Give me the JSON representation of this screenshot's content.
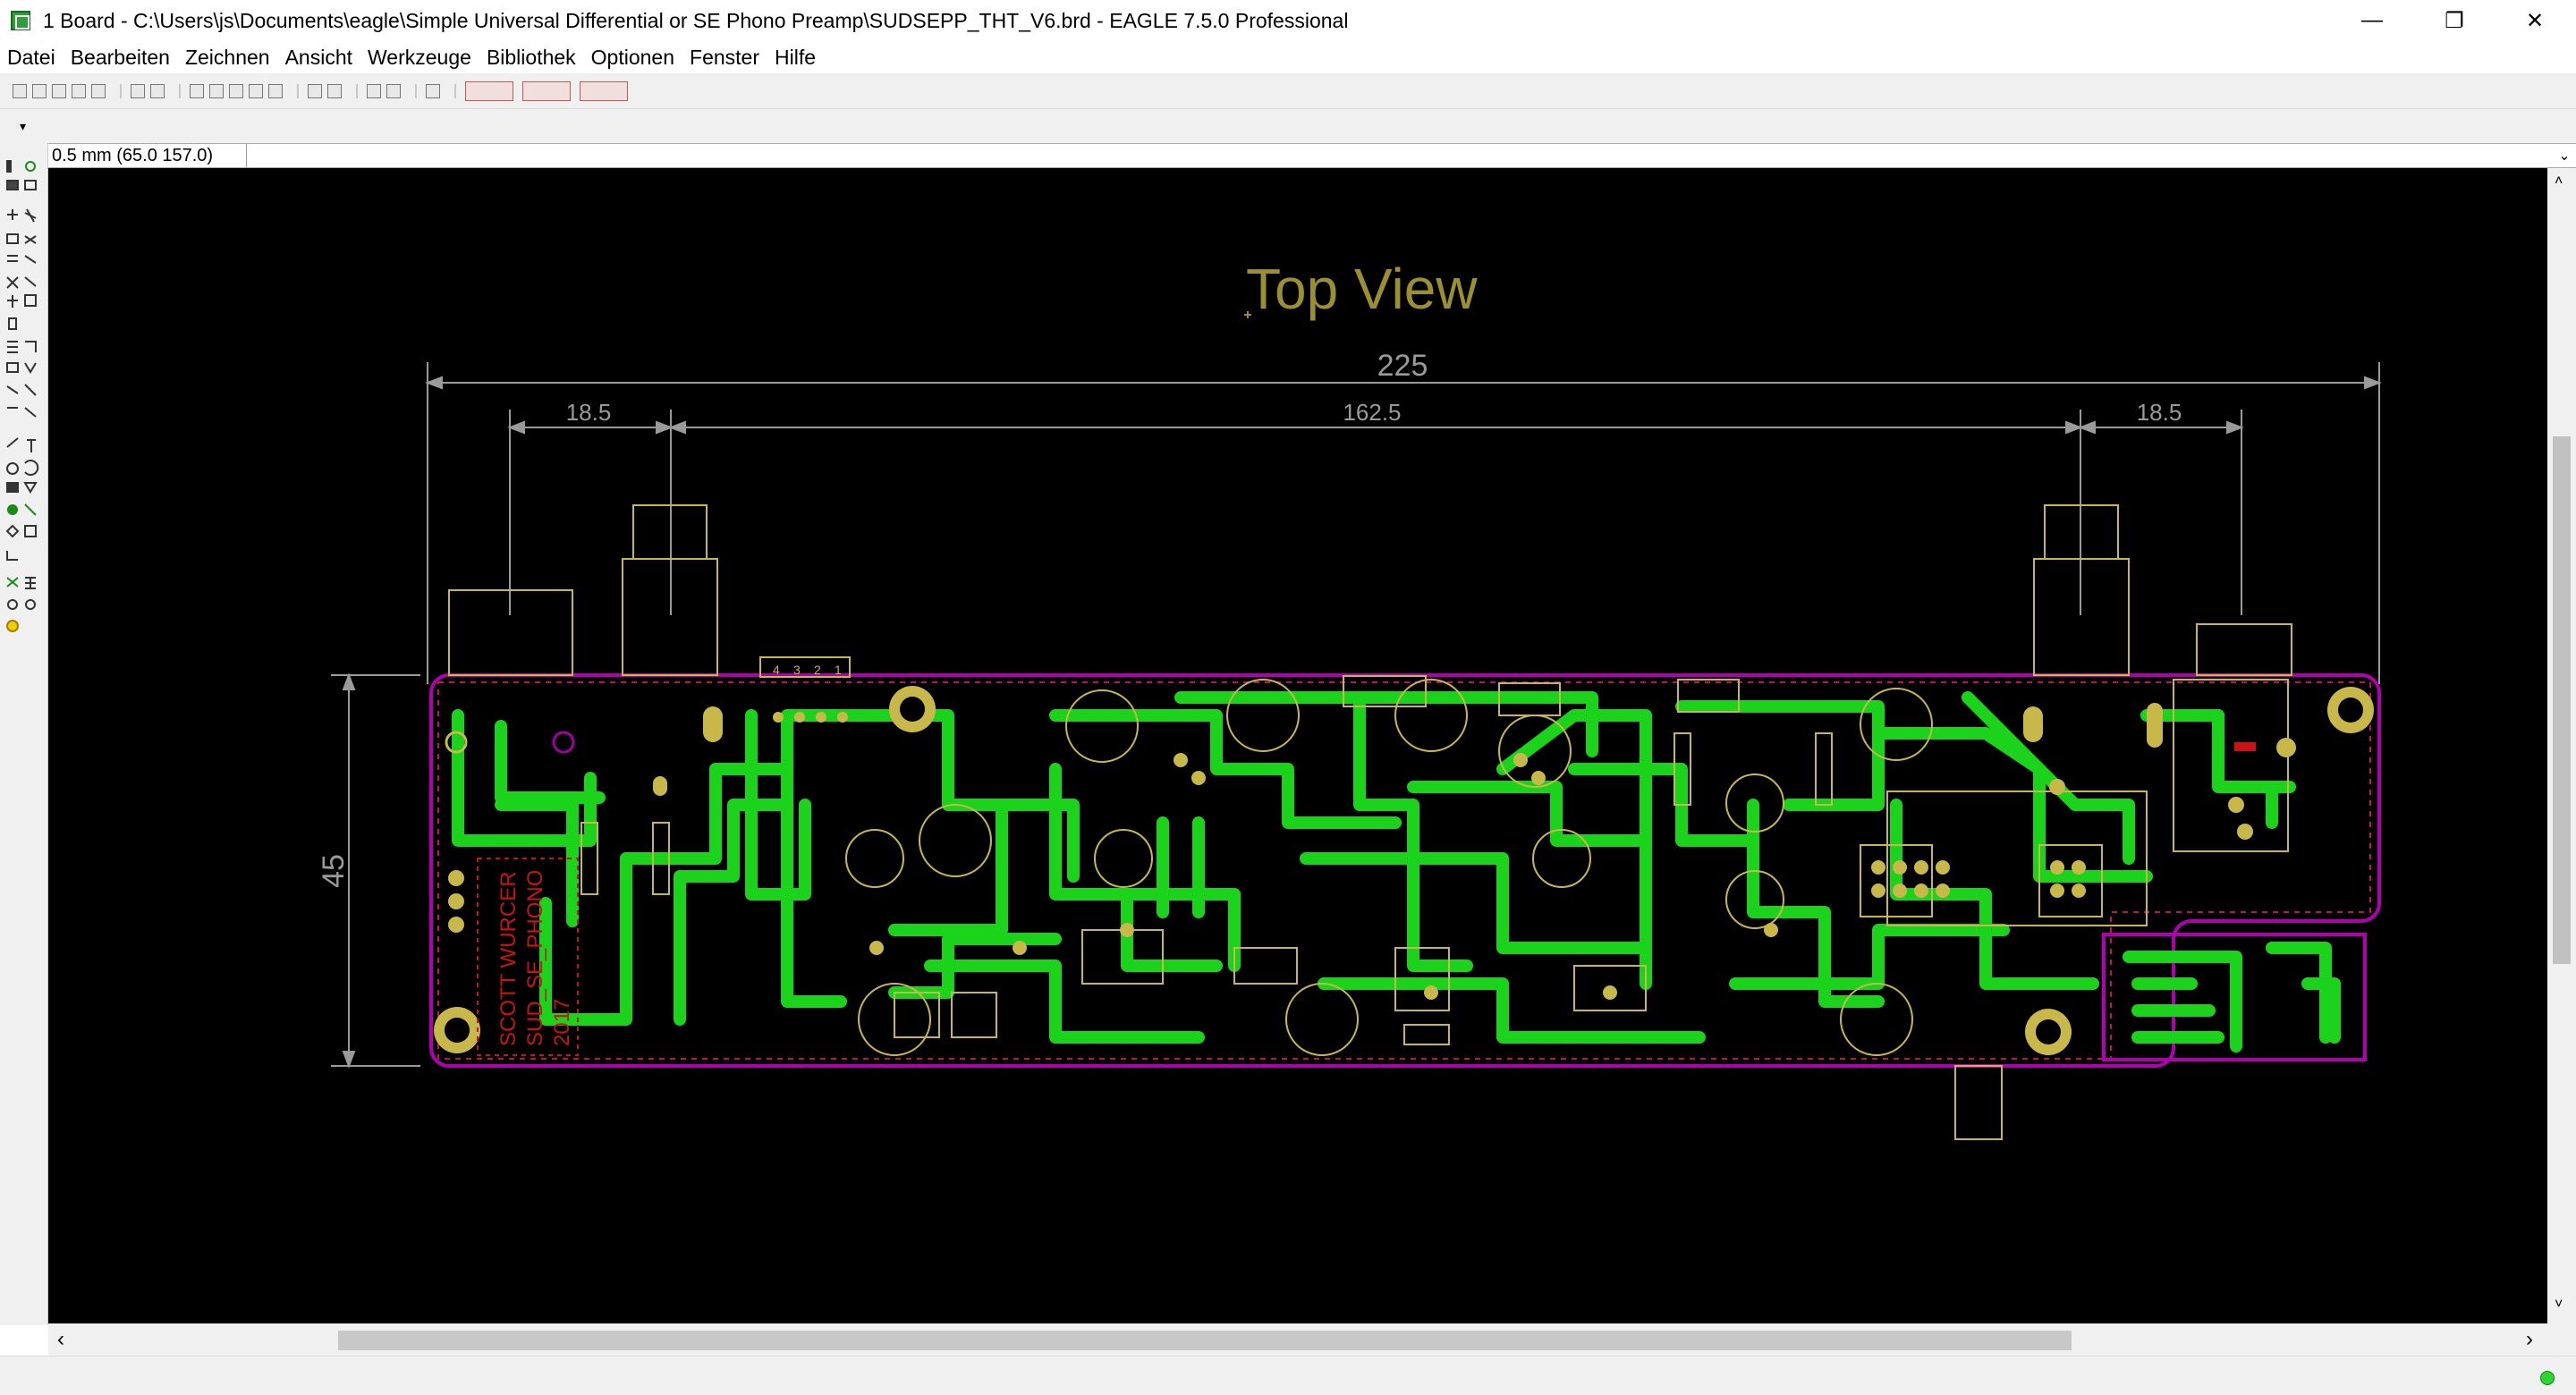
{
  "window": {
    "title": "1 Board - C:\\Users\\js\\Documents\\eagle\\Simple Universal Differential or SE Phono Preamp\\SUDSEPP_THT_V6.brd - EAGLE 7.5.0 Professional",
    "minimize": "—",
    "restore": "❐",
    "close": "✕"
  },
  "menu": [
    "Datei",
    "Bearbeiten",
    "Zeichnen",
    "Ansicht",
    "Werkzeuge",
    "Bibliothek",
    "Optionen",
    "Fenster",
    "Hilfe"
  ],
  "command": {
    "coordinate": "0.5 mm (65.0 157.0)",
    "input_value": "",
    "dropdown": "⌄"
  },
  "toolbar": {
    "logos": [
      "",
      "",
      ""
    ]
  },
  "board": {
    "caption": "Top View",
    "silkscreen": [
      "SCOTT WURCER",
      "SUD_SE_PHONO",
      "2017"
    ],
    "pin_labels": [
      "4",
      "3",
      "2",
      "1"
    ]
  },
  "dimensions": {
    "overall": "225",
    "left": "18.5",
    "middle": "162.5",
    "right": "18.5",
    "height": "45"
  },
  "colors": {
    "canvas": "#000000",
    "copper_top": "#1bd31b",
    "outline": "#b000b0",
    "component": "#c8b84a",
    "dimension": "#9a9a9a",
    "silkscreen": "#c81414",
    "caption": "#9a9030"
  },
  "scrollbars": {
    "up": "˄",
    "down": "˅",
    "left": "‹",
    "right": "›"
  }
}
